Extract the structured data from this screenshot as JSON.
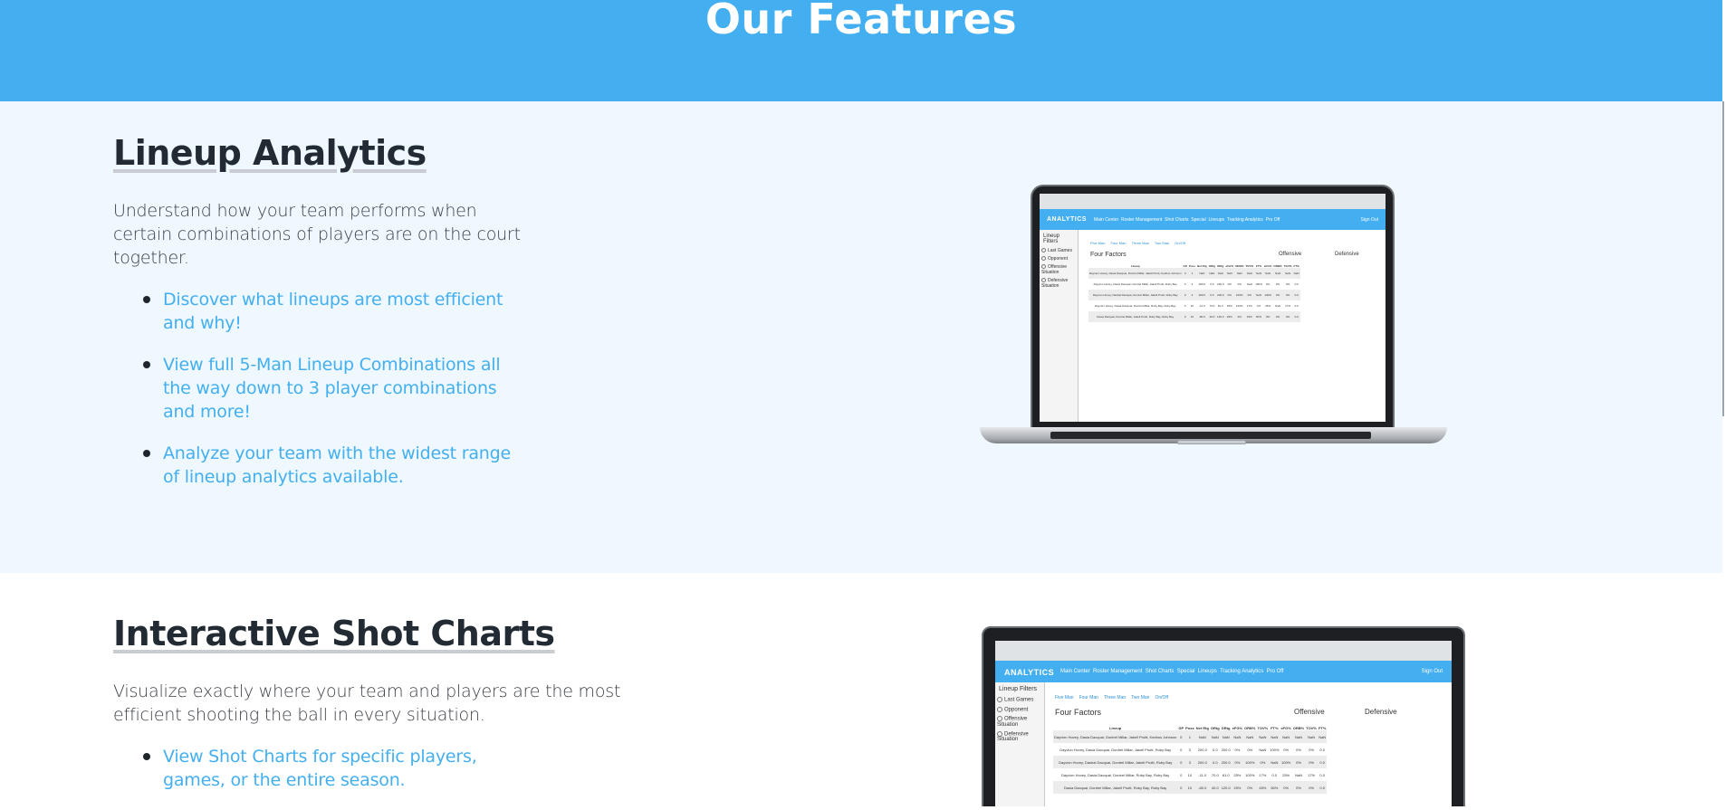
{
  "hero": {
    "title": "Our Features"
  },
  "colors": {
    "accent": "#44aff0",
    "section_bg": "#eef8fe",
    "text_dark": "#222b33"
  },
  "features": [
    {
      "title": "Lineup Analytics",
      "description": "Understand how your team performs when certain combinations of players are on the court together.",
      "bullets": [
        "Discover what lineups are most efficient and why!",
        "View full 5-Man Lineup Combinations all the way down to 3 player combinations and more!",
        "Analyze your team with the widest range of lineup analytics available."
      ]
    },
    {
      "title": "Interactive Shot Charts",
      "description": "Visualize exactly where your team and players are the most efficient shooting the ball in every situation.",
      "bullets": [
        "View Shot Charts for specific players, games, or the entire season."
      ]
    }
  ],
  "screen_mock": {
    "logo": "ANALYTICS",
    "nav": [
      "Main Center",
      "Roster Management",
      "Shot Charts",
      "Special",
      "Lineups",
      "Tracking Analytics",
      "Pro Off"
    ],
    "sign_out": "Sign Out",
    "filters_title": "Lineup Filters",
    "filters": [
      "Last Games",
      "Opponent",
      "Offensive Situation",
      "Defensive Situation"
    ],
    "tabs": [
      "Five Man",
      "Four Man",
      "Three Man",
      "Two Man",
      "On/Off"
    ],
    "section_title": "Four Factors",
    "group_offensive": "Offensive",
    "group_defensive": "Defensive",
    "columns": [
      "Lineup",
      "GP",
      "Poss",
      "Net Rtg",
      "ORtg",
      "DRtg",
      "eFG%",
      "ORB%",
      "TOV%",
      "FT%",
      "eFG%",
      "ORB%",
      "TOV%",
      "FT%"
    ],
    "rows": [
      [
        "Dayvion Hovey, Dasia Dacquai, Dontrel Millar, Jakell Pruitt, Kedrius Johnson",
        "0",
        "1",
        "NaN",
        "NaN",
        "NaN",
        "NaN",
        "NaN",
        "NaN",
        "NaN",
        "NaN",
        "NaN",
        "NaN",
        "NaN"
      ],
      [
        "Dayvion Hovey, Dasia Dacquai, Dontrel Millar, Jakell Pruitt, Ruby Bay",
        "0",
        "3",
        "200.0",
        "0.0",
        "200.0",
        "0%",
        "0%",
        "NaN",
        "100%",
        "0%",
        "0%",
        "0%",
        "0.0"
      ],
      [
        "Dayvion Hovey, Dashal Dacquai, Dontrel Millar, Jakell Pruitt, Ruby Bay",
        "0",
        "3",
        "200.0",
        "0.0",
        "200.0",
        "0%",
        "100%",
        "0%",
        "NaN",
        "100%",
        "0%",
        "0%",
        "0.0"
      ],
      [
        "Dayvion Hovey, Dasia Dacquai, Dontrel Millar, Ruby Bay, Ruby Bay",
        "0",
        "10",
        "-11.0",
        "70.0",
        "81.0",
        "25%",
        "100%",
        "17%",
        "0.0",
        "25%",
        "NaN",
        "17%",
        "0.0"
      ],
      [
        "Dasia Dacquai, Dontrel Millar, Jakell Pruitt, Ruby Bay, Ruby Bay",
        "0",
        "10",
        "-80.0",
        "40.0",
        "120.0",
        "25%",
        "0%",
        "45%",
        "50%",
        "0%",
        "0%",
        "0%",
        "0.0"
      ]
    ]
  }
}
